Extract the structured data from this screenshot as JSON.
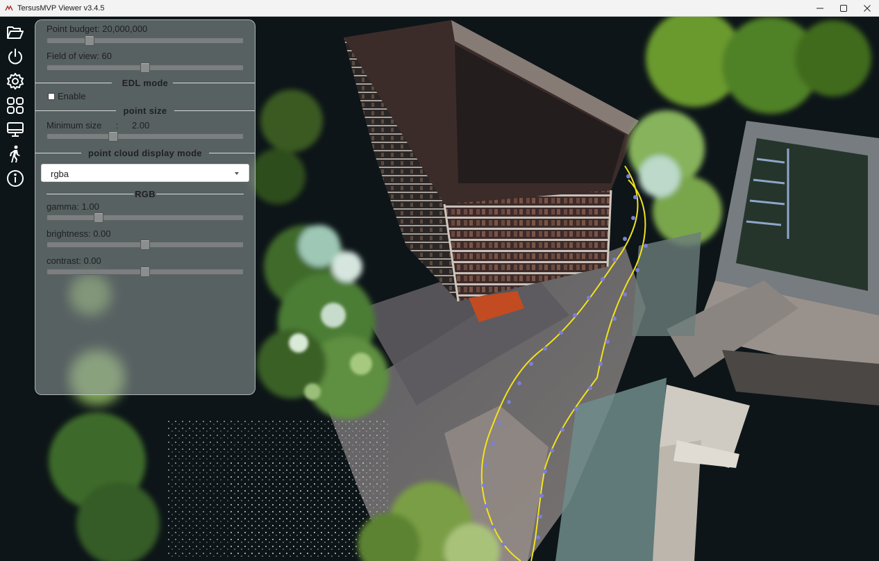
{
  "window": {
    "title": "TersusMVP Viewer v3.4.5"
  },
  "toolbar": {
    "icons": [
      "folder-open-icon",
      "power-icon",
      "gear-icon",
      "grid-icon",
      "monitor-icon",
      "walking-person-icon",
      "info-icon"
    ]
  },
  "panel": {
    "point_budget_label": "Point budget: 20,000,000",
    "point_budget_fraction": 0.2,
    "fov_label": "Field of view: 60",
    "fov_fraction": 0.5,
    "edl_section": "EDL mode",
    "edl_enable_label": "Enable",
    "edl_enabled": false,
    "point_size_section": "point size",
    "min_size_label": "Minimum size",
    "min_size_colon": ":",
    "min_size_value": "2.00",
    "min_size_fraction": 0.33,
    "display_mode_section": "point cloud display mode",
    "display_mode_value": "rgba",
    "rgb_section": "RGB",
    "gamma_label": "gamma: 1.00",
    "gamma_fraction": 0.25,
    "brightness_label": "brightness: 0.00",
    "brightness_fraction": 0.5,
    "contrast_label": "contrast: 0.00",
    "contrast_fraction": 0.5
  },
  "colors": {
    "panel_bg": "#96a0a0",
    "trajectory": "#f2e21d",
    "trajectory_nodes": "#7a7fd6"
  }
}
